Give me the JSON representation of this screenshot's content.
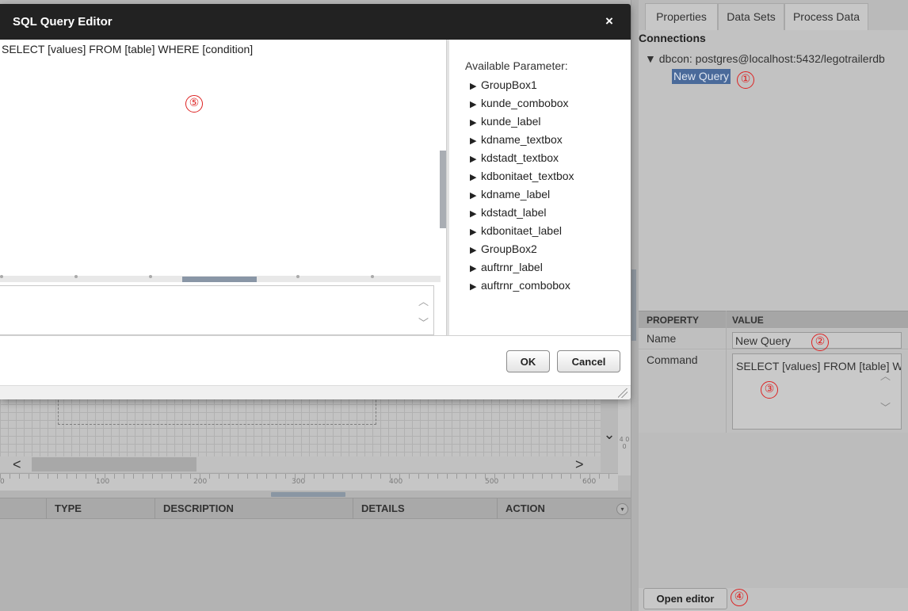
{
  "dialog": {
    "title": "SQL Query Editor",
    "close_glyph": "×",
    "sql_text": "SELECT [values] FROM [table] WHERE [condition]",
    "parameters_title": "Available Parameter:",
    "parameters": [
      "GroupBox1",
      "kunde_combobox",
      "kunde_label",
      "kdname_textbox",
      "kdstadt_textbox",
      "kdbonitaet_textbox",
      "kdname_label",
      "kdstadt_label",
      "kdbonitaet_label",
      "GroupBox2",
      "auftrnr_label",
      "auftrnr_combobox"
    ],
    "ok_label": "OK",
    "cancel_label": "Cancel"
  },
  "canvas": {
    "ruler_ticks": [
      "0",
      "100",
      "200",
      "300",
      "400",
      "500",
      "600"
    ],
    "vruler_text": "4 0 0",
    "scroll_left": "<",
    "scroll_right": ">",
    "scroll_down": "⌄"
  },
  "event_table": {
    "columns": [
      "TYPE",
      "DESCRIPTION",
      "DETAILS",
      "ACTION"
    ],
    "menu_glyph": "▾"
  },
  "right_panel": {
    "tabs": [
      "Properties",
      "Data Sets",
      "Process Data"
    ],
    "active_tab": "Data Sets",
    "connections_title": "Connections",
    "connection_label": "▼ dbcon: postgres@localhost:5432/legotrailerdb",
    "new_query_label": "New Query",
    "property_grid": {
      "header_property": "PROPERTY",
      "header_value": "VALUE",
      "name_label": "Name",
      "name_value": "New Query",
      "command_label": "Command",
      "command_value": "SELECT [values] FROM [table] WHERE [condition]"
    },
    "open_editor_label": "Open editor"
  },
  "callouts": [
    "①",
    "②",
    "③",
    "④",
    "⑤"
  ],
  "colors": {
    "dialog_titlebar": "#222222",
    "selection": "#4a6a9a",
    "callout": "#dd2222",
    "scroll_thumb": "#8996a6"
  }
}
